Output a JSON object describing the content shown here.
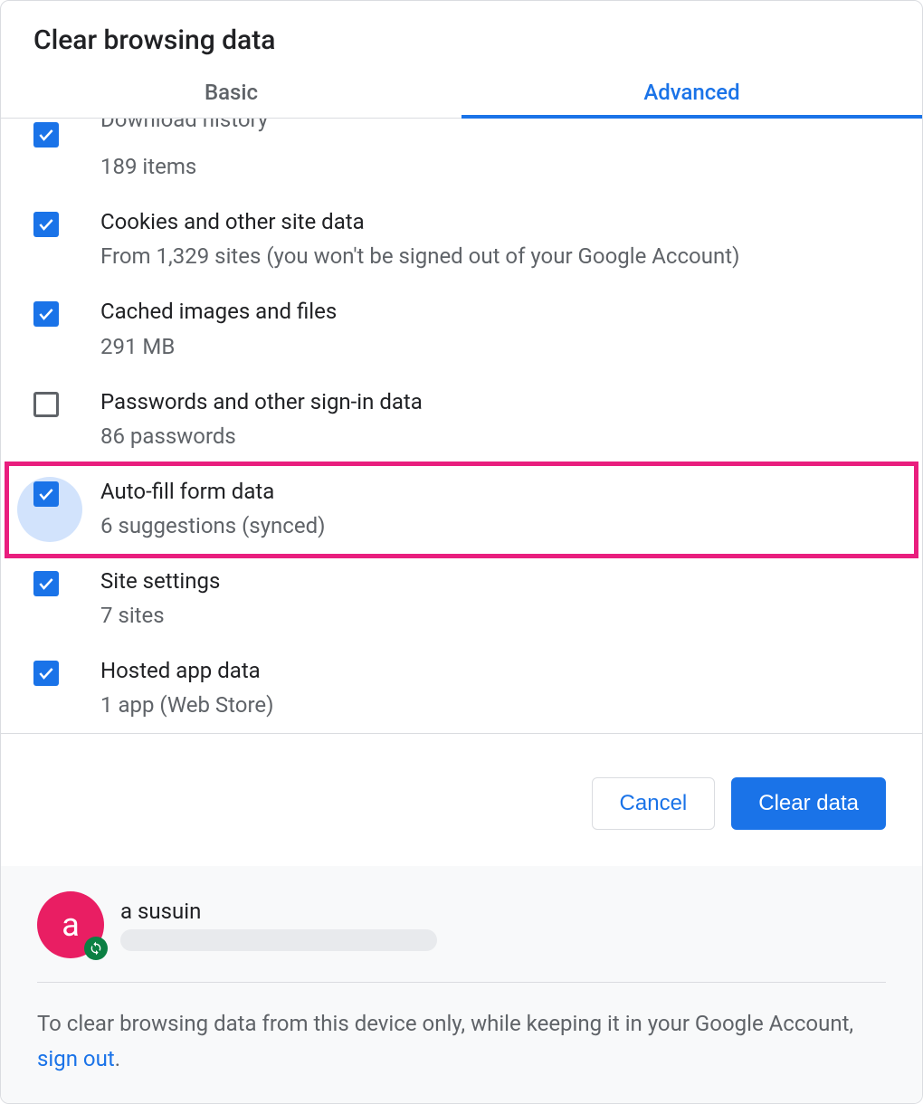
{
  "dialog": {
    "title": "Clear browsing data"
  },
  "tabs": {
    "basic": "Basic",
    "advanced": "Advanced",
    "active": "advanced"
  },
  "items": [
    {
      "title": "Download history",
      "sub": "189 items",
      "checked": true,
      "cut_top": true
    },
    {
      "title": "Cookies and other site data",
      "sub": "From 1,329 sites (you won't be signed out of your Google Account)",
      "checked": true
    },
    {
      "title": "Cached images and files",
      "sub": "291 MB",
      "checked": true
    },
    {
      "title": "Passwords and other sign-in data",
      "sub": "86 passwords",
      "checked": false
    },
    {
      "title": "Auto-fill form data",
      "sub": "6 suggestions (synced)",
      "checked": true,
      "highlighted": true
    },
    {
      "title": "Site settings",
      "sub": "7 sites",
      "checked": true
    },
    {
      "title": "Hosted app data",
      "sub": "1 app (Web Store)",
      "checked": true
    }
  ],
  "buttons": {
    "cancel": "Cancel",
    "clear": "Clear data"
  },
  "account": {
    "initial": "a",
    "name": "a susuin"
  },
  "footer": {
    "text_before": "To clear browsing data from this device only, while keeping it in your Google Account, ",
    "link": "sign out",
    "text_after": "."
  }
}
